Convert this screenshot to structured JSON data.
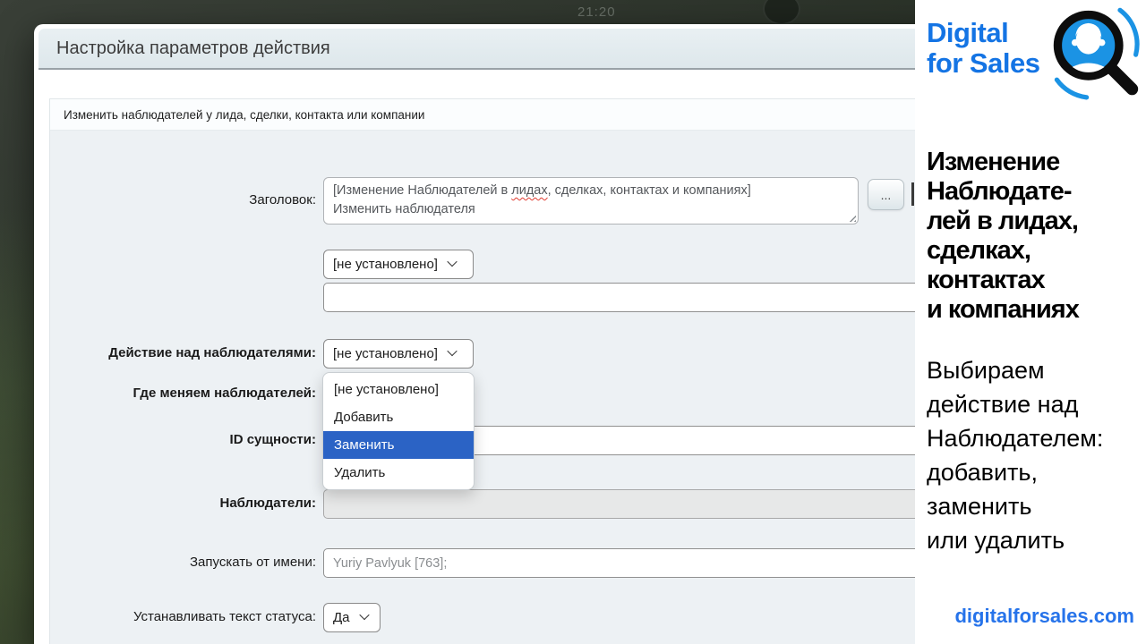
{
  "backdrop": {
    "clock": "21:20"
  },
  "dialog": {
    "title": "Настройка параметров действия",
    "subtitle": "Изменить наблюдателей у лида, сделки, контакта или компании"
  },
  "form": {
    "title_field": {
      "label": "Заголовок:",
      "line1_pre": "[Изменение Наблюдателей в ",
      "line1_typo": "лидах",
      "line1_post": ", сделках, контактах и компаниях]",
      "line2": "Изменить наблюдателя",
      "more_button": "..."
    },
    "where": {
      "label": "Где меняем наблюдателей:",
      "value": "[не установлено]"
    },
    "action": {
      "label": "Действие над наблюдателями:",
      "value": "[не установлено]",
      "options": [
        "[не установлено]",
        "Добавить",
        "Заменить",
        "Удалить"
      ],
      "selected_option": "Заменить"
    },
    "entity_id": {
      "label": "ID сущности:"
    },
    "observers": {
      "label": "Наблюдатели:"
    },
    "run_as": {
      "label": "Запускать от имени:",
      "value": "Yuriy Pavlyuk [763];"
    },
    "status_text": {
      "label": "Устанавливать текст статуса:",
      "value": "Да"
    }
  },
  "sidebar": {
    "brand": {
      "line1": "Digital",
      "line2": "for Sales"
    },
    "heading": [
      "Изменение",
      "Наблюдате-",
      "лей в лидах,",
      "сделках,",
      "контактах",
      "и компаниях"
    ],
    "body": [
      "Выбираем",
      "действие над",
      "Наблюдателем:",
      "добавить,",
      "заменить",
      "или удалить"
    ],
    "website": "digitalforsales.com"
  },
  "colors": {
    "brand_blue": "#1474e4",
    "select_highlight": "#2b63c5"
  }
}
